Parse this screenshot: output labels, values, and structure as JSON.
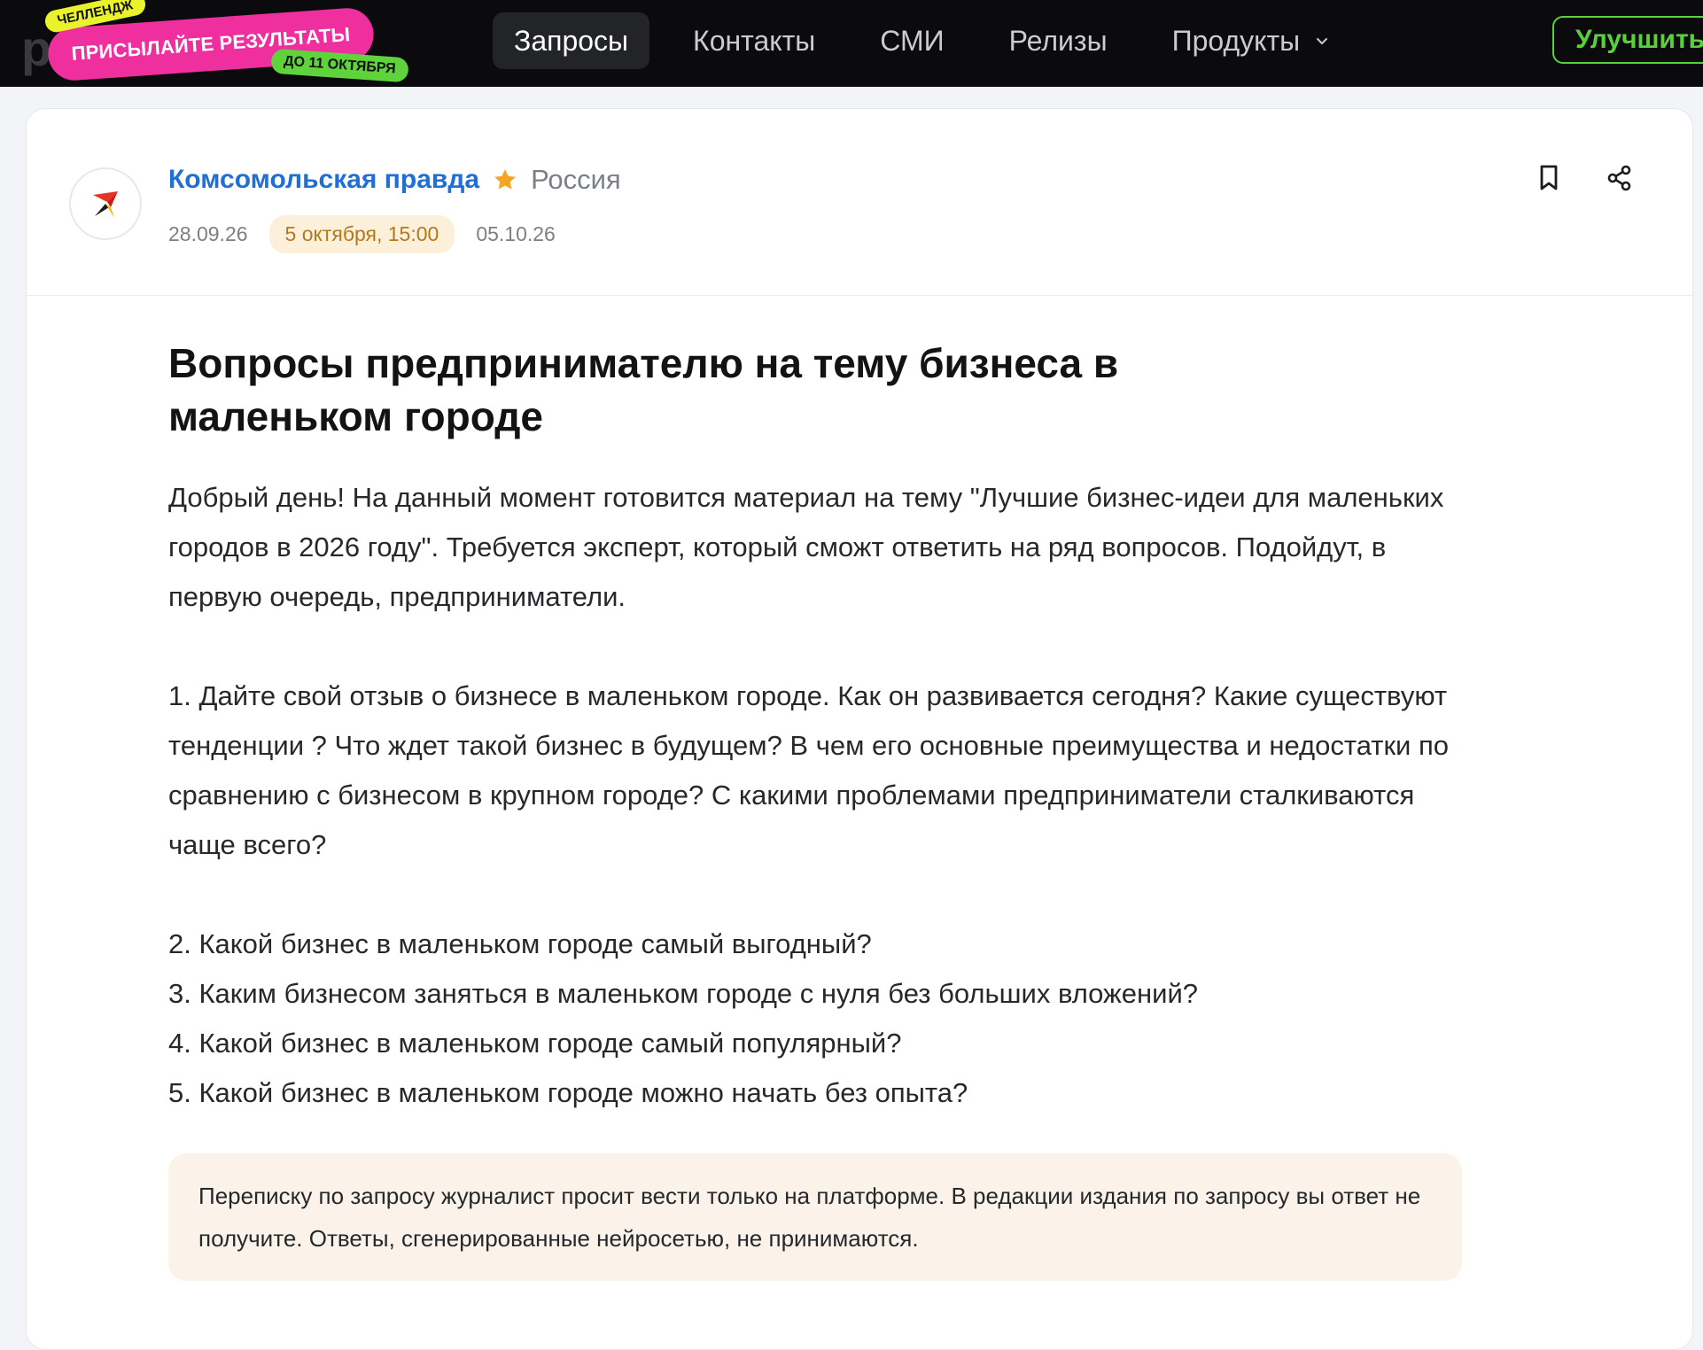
{
  "promo": {
    "tag": "ЧЕЛЛЕНДЖ",
    "main": "ПРИСЫЛАЙТЕ РЕЗУЛЬТАТЫ",
    "deadline": "ДО 11 ОКТЯБРЯ"
  },
  "nav": {
    "items": [
      {
        "label": "Запросы",
        "active": true
      },
      {
        "label": "Контакты"
      },
      {
        "label": "СМИ"
      },
      {
        "label": "Релизы"
      },
      {
        "label": "Продукты"
      }
    ],
    "upgrade_label": "Улучшить"
  },
  "request": {
    "outlet": "Комсомольская правда",
    "country": "Россия",
    "published": "28.09.26",
    "deadline": "5 октября, 15:00",
    "expires": "05.10.26",
    "title": "Вопросы предпринимателю на тему бизнеса в маленьком городе",
    "intro": "Добрый день! На данный момент готовится материал на тему \"Лучшие бизнес-идеи для маленьких городов в 2026 году\". Требуется эксперт, который сможт ответить на ряд вопросов. Подойдут, в первую очередь, предприниматели.",
    "q1": "1. Дайте свой отзыв о бизнесе в маленьком городе. Как он развивается сегодня? Какие существуют тенденции ? Что ждет такой бизнес в будущем? В чем его основные преимущества и недостатки по сравнению с бизнесом в крупном городе? С какими проблемами предприниматели сталкиваются чаще всего?",
    "questions": [
      "2. Какой бизнес в маленьком городе самый выгодный?",
      "3. Каким бизнесом заняться в маленьком городе с нуля без больших вложений?",
      "4. Какой бизнес в маленьком городе самый популярный?",
      "5. Какой бизнес в маленьком городе можно начать без опыта?"
    ],
    "notice": "Переписку по запросу журналист просит вести только на платформе. В редакции издания по запросу вы ответ не получите. Ответы, сгенерированные нейросетью, не принимаются."
  },
  "colors": {
    "accent_link": "#1f6fd6",
    "star": "#f5a524",
    "promo_pink": "#ee2f9d",
    "promo_green": "#5ed33b",
    "upgrade_green": "#59d13a"
  },
  "icons": [
    "outlet-logo-icon",
    "star-icon",
    "bookmark-icon",
    "share-icon",
    "chevron-down-icon"
  ]
}
